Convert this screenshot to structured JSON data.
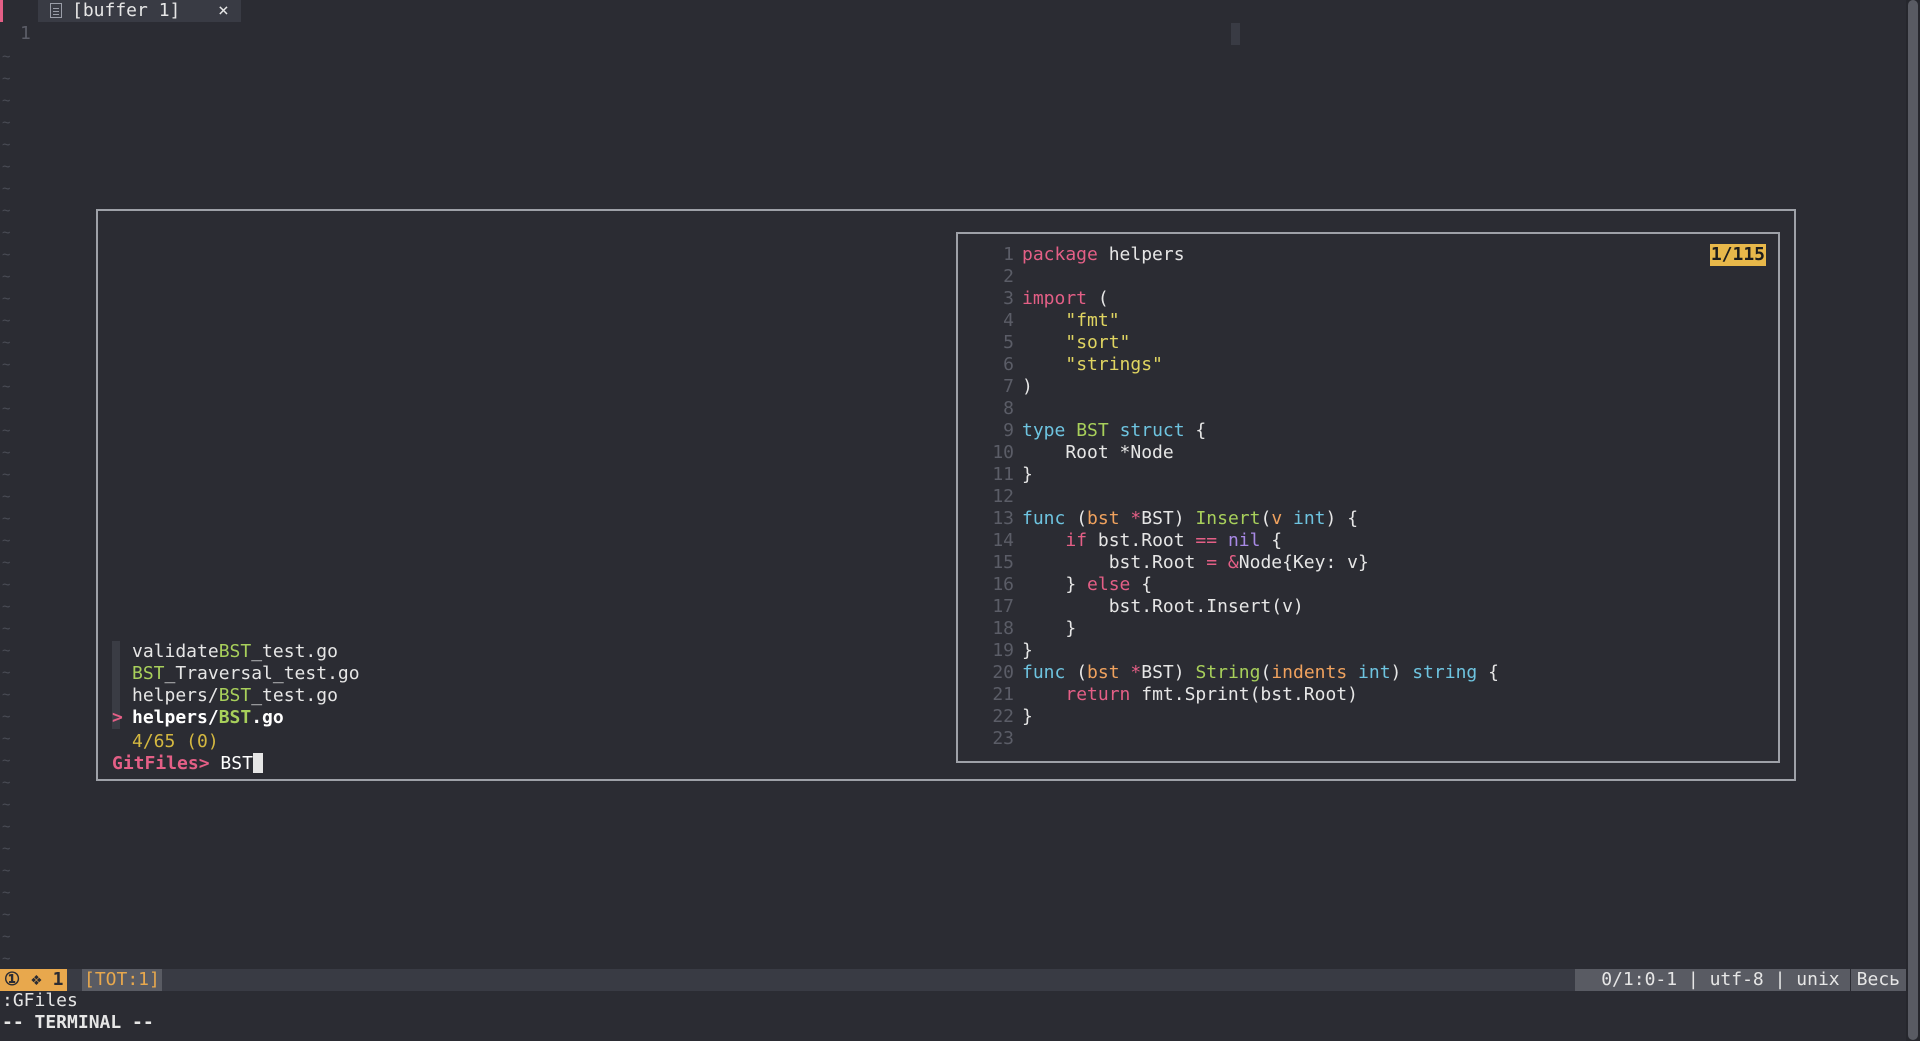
{
  "tab": {
    "label": "[buffer 1]",
    "close": "×"
  },
  "editor": {
    "line_number": "1",
    "tilde": "~"
  },
  "fzf": {
    "results": [
      {
        "prefix": "validate",
        "match": "BST",
        "suffix": "_test.go",
        "selected": false
      },
      {
        "prefix": "",
        "match": "BST",
        "suffix": "_Traversal_test.go",
        "selected": false
      },
      {
        "prefix": "helpers/",
        "match": "BST",
        "suffix": "_test.go",
        "selected": false
      },
      {
        "prefix": "helpers/",
        "match": "BST",
        "suffix": ".go",
        "selected": true
      }
    ],
    "selected_marker": ">",
    "count": "4/65 (0)",
    "prompt_label": "GitFiles>",
    "query": "BST"
  },
  "preview": {
    "position": "1/115",
    "lines": [
      "package helpers",
      "",
      "import (",
      "    \"fmt\"",
      "    \"sort\"",
      "    \"strings\"",
      ")",
      "",
      "type BST struct {",
      "    Root *Node",
      "}",
      "",
      "func (bst *BST) Insert(v int) {",
      "    if bst.Root == nil {",
      "        bst.Root = &Node{Key: v}",
      "    } else {",
      "        bst.Root.Insert(v)",
      "    }",
      "}",
      "func (bst *BST) String(indents int) string {",
      "    return fmt.Sprint(bst.Root)",
      "}",
      ""
    ]
  },
  "statusline": {
    "mode": "① ❖ 1",
    "tot": "[TOT:1]",
    "info": "0/1:0-1 | utf-8 | unix",
    "position": "Весь"
  },
  "cmdline": ":GFiles",
  "modeline": "-- TERMINAL --",
  "colors": {
    "background": "#2b2c33",
    "accent_pink": "#e45f86",
    "match_green": "#a8d05b",
    "count_yellow": "#d4b840",
    "status_orange": "#e8a84d"
  }
}
